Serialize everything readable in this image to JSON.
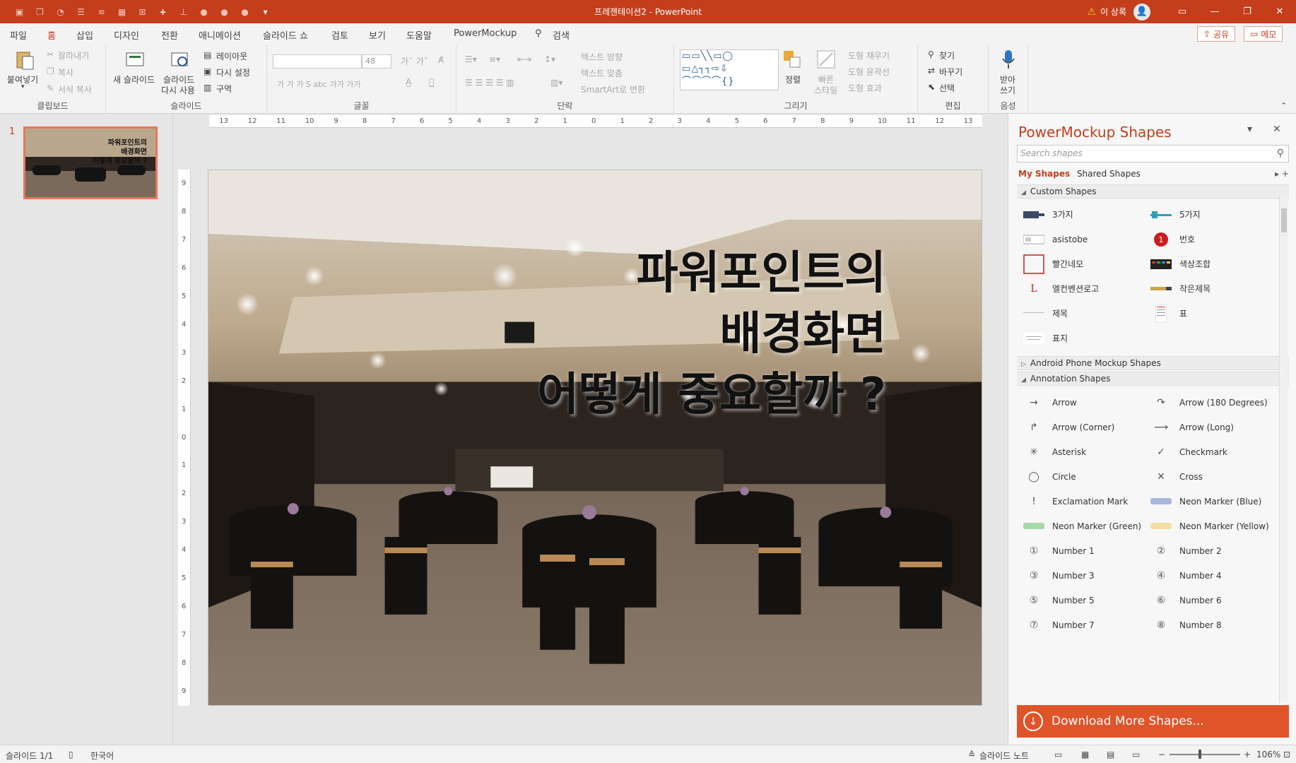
{
  "app": {
    "title": "프레젠테이션2  -  PowerPoint",
    "user": "이 상록",
    "window_controls": [
      "restore-icon",
      "minimize-icon",
      "maximize-icon",
      "close-icon"
    ]
  },
  "menu": {
    "tabs": [
      "파일",
      "홈",
      "삽입",
      "디자인",
      "전환",
      "애니메이션",
      "슬라이드 쇼",
      "검토",
      "보기",
      "도움말",
      "PowerMockup"
    ],
    "active": "홈",
    "search": "검색",
    "share": "공유",
    "memo": "메모"
  },
  "ribbon": {
    "clipboard": {
      "label": "클립보드",
      "paste": "붙여넣기",
      "cut": "잘라내기",
      "copy": "복사",
      "format": "서식 복사"
    },
    "slides": {
      "label": "슬라이드",
      "new_slide": "새 슬라이드",
      "reuse1": "슬라이드",
      "reuse2": "다시 사용",
      "layout": "레이아웃",
      "reset": "다시 설정",
      "section": "구역"
    },
    "font": {
      "label": "글꼴",
      "size": "48",
      "styles": "가  가  가  S  abc  가가  가가"
    },
    "paragraph": {
      "label": "단락",
      "text_direction": "텍스트 방향",
      "align_text": "텍스트 맞춤",
      "smartart": "SmartArt로 변환"
    },
    "drawing": {
      "label": "그리기",
      "arrange": "정렬",
      "quick_styles1": "빠른",
      "quick_styles2": "스타일",
      "shape_fill": "도형 채우기",
      "shape_outline": "도형 윤곽선",
      "shape_effects": "도형 효과"
    },
    "editing": {
      "label": "편집",
      "find": "찾기",
      "replace": "바꾸기",
      "select": "선택"
    },
    "voice": {
      "label": "음성",
      "dictate1": "받아",
      "dictate2": "쓰기"
    }
  },
  "slides_pane": {
    "number": "1",
    "thumb_title": [
      "파워포인트의",
      "배경화면",
      "어떻게 중요할까 ?"
    ]
  },
  "rulers": {
    "h": [
      "13",
      "12",
      "11",
      "10",
      "9",
      "8",
      "7",
      "6",
      "5",
      "4",
      "3",
      "2",
      "1",
      "0",
      "1",
      "2",
      "3",
      "4",
      "5",
      "6",
      "7",
      "8",
      "9",
      "10",
      "11",
      "12",
      "13"
    ],
    "v": [
      "9",
      "8",
      "7",
      "6",
      "5",
      "4",
      "3",
      "2",
      "1",
      "0",
      "1",
      "2",
      "3",
      "4",
      "5",
      "6",
      "7",
      "8",
      "9"
    ]
  },
  "slide": {
    "title_lines": [
      "파워포인트의",
      "배경화면",
      "어떻게 중요할까 ?"
    ]
  },
  "panel": {
    "title": "PowerMockup Shapes",
    "search_placeholder": "Search shapes",
    "tab_my": "My Shapes",
    "tab_shared": "Shared Shapes",
    "sections": {
      "custom": "Custom Shapes",
      "android": "Android Phone Mockup Shapes",
      "annotation": "Annotation Shapes"
    },
    "custom_items": [
      "3가지",
      "5가지",
      "asistobe",
      "번호",
      "빨간네모",
      "색상조합",
      "엘컨벤션로고",
      "작은제목",
      "제목",
      "표",
      "표지"
    ],
    "annotation_items": [
      "Arrow",
      "Arrow (180 Degrees)",
      "Arrow (Corner)",
      "Arrow (Long)",
      "Asterisk",
      "Checkmark",
      "Circle",
      "Cross",
      "Exclamation Mark",
      "Neon Marker (Blue)",
      "Neon Marker (Green)",
      "Neon Marker (Yellow)",
      "Number 1",
      "Number 2",
      "Number 3",
      "Number 4",
      "Number 5",
      "Number 6",
      "Number 7",
      "Number 8"
    ],
    "download": "Download More Shapes..."
  },
  "status": {
    "slide": "슬라이드 1/1",
    "language": "한국어",
    "notes": "슬라이드 노트",
    "zoom": "106%"
  }
}
